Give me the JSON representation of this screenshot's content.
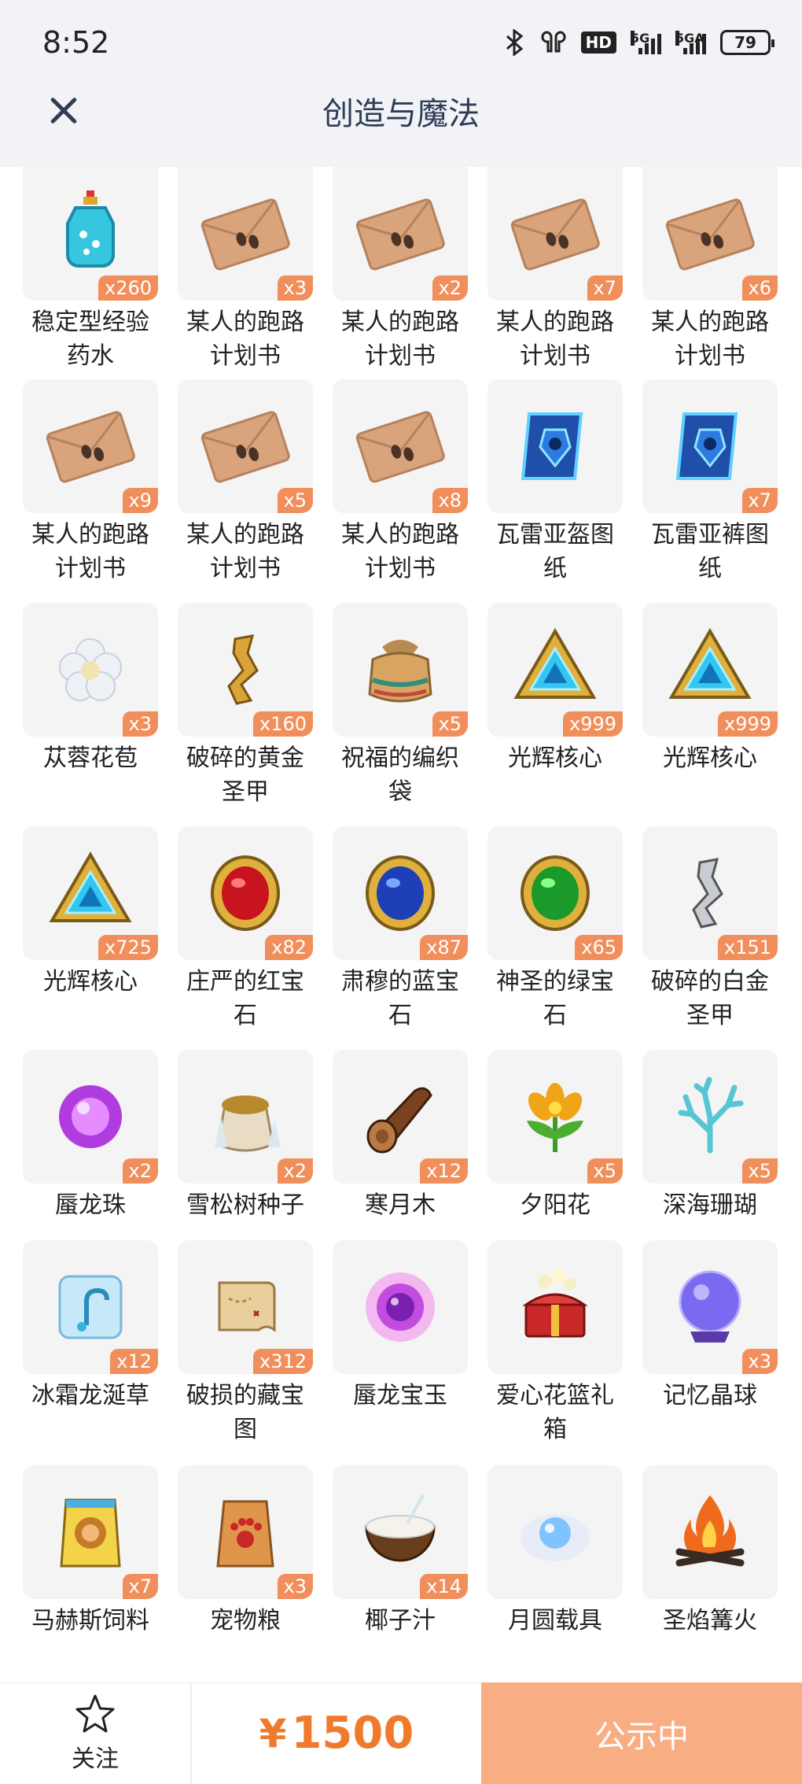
{
  "status": {
    "time": "8:52",
    "battery": "79",
    "hd": "HD",
    "sig1": "5G",
    "sig2": "5GA"
  },
  "header": {
    "title": "创造与魔法"
  },
  "items": [
    {
      "name": "稳定型经验药水",
      "lines": [
        "稳定型经验",
        "药水"
      ],
      "qty": "x260",
      "icon": "potion"
    },
    {
      "name": "某人的跑路计划书",
      "lines": [
        "某人的跑路",
        "计划书"
      ],
      "qty": "x3",
      "icon": "envelope"
    },
    {
      "name": "某人的跑路计划书",
      "lines": [
        "某人的跑路",
        "计划书"
      ],
      "qty": "x2",
      "icon": "envelope"
    },
    {
      "name": "某人的跑路计划书",
      "lines": [
        "某人的跑路",
        "计划书"
      ],
      "qty": "x7",
      "icon": "envelope"
    },
    {
      "name": "某人的跑路计划书",
      "lines": [
        "某人的跑路",
        "计划书"
      ],
      "qty": "x6",
      "icon": "envelope"
    },
    {
      "name": "某人的跑路计划书",
      "lines": [
        "某人的跑路",
        "计划书"
      ],
      "qty": "x9",
      "icon": "envelope"
    },
    {
      "name": "某人的跑路计划书",
      "lines": [
        "某人的跑路",
        "计划书"
      ],
      "qty": "x5",
      "icon": "envelope"
    },
    {
      "name": "某人的跑路计划书",
      "lines": [
        "某人的跑路",
        "计划书"
      ],
      "qty": "x8",
      "icon": "envelope"
    },
    {
      "name": "瓦雷亚盔图纸",
      "lines": [
        "瓦雷亚盔图",
        "纸"
      ],
      "qty": "",
      "icon": "blueprint"
    },
    {
      "name": "瓦雷亚裤图纸",
      "lines": [
        "瓦雷亚裤图",
        "纸"
      ],
      "qty": "x7",
      "icon": "blueprint"
    },
    {
      "name": "苁蓉花苞",
      "lines": [
        "苁蓉花苞"
      ],
      "qty": "x3",
      "icon": "flower-bud"
    },
    {
      "name": "破碎的黄金圣甲",
      "lines": [
        "破碎的黄金",
        "圣甲"
      ],
      "qty": "x160",
      "icon": "gold-shard"
    },
    {
      "name": "祝福的编织袋",
      "lines": [
        "祝福的编织",
        "袋"
      ],
      "qty": "x5",
      "icon": "woven-bag"
    },
    {
      "name": "光辉核心",
      "lines": [
        "光辉核心"
      ],
      "qty": "x999",
      "icon": "radiant-core"
    },
    {
      "name": "光辉核心",
      "lines": [
        "光辉核心"
      ],
      "qty": "x999",
      "icon": "radiant-core"
    },
    {
      "name": "光辉核心",
      "lines": [
        "光辉核心"
      ],
      "qty": "x725",
      "icon": "radiant-core"
    },
    {
      "name": "庄严的红宝石",
      "lines": [
        "庄严的红宝",
        "石"
      ],
      "qty": "x82",
      "icon": "red-gem"
    },
    {
      "name": "肃穆的蓝宝石",
      "lines": [
        "肃穆的蓝宝",
        "石"
      ],
      "qty": "x87",
      "icon": "blue-gem"
    },
    {
      "name": "神圣的绿宝石",
      "lines": [
        "神圣的绿宝",
        "石"
      ],
      "qty": "x65",
      "icon": "green-gem"
    },
    {
      "name": "破碎的白金圣甲",
      "lines": [
        "破碎的白金",
        "圣甲"
      ],
      "qty": "x151",
      "icon": "silver-shard"
    },
    {
      "name": "蜃龙珠",
      "lines": [
        "蜃龙珠"
      ],
      "qty": "x2",
      "icon": "purple-orb"
    },
    {
      "name": "雪松树种子",
      "lines": [
        "雪松树种子"
      ],
      "qty": "x2",
      "icon": "seed-sack"
    },
    {
      "name": "寒月木",
      "lines": [
        "寒月木"
      ],
      "qty": "x12",
      "icon": "log"
    },
    {
      "name": "夕阳花",
      "lines": [
        "夕阳花"
      ],
      "qty": "x5",
      "icon": "sunset-flower"
    },
    {
      "name": "深海珊瑚",
      "lines": [
        "深海珊瑚"
      ],
      "qty": "x5",
      "icon": "coral"
    },
    {
      "name": "冰霜龙涎草",
      "lines": [
        "冰霜龙涎草"
      ],
      "qty": "x12",
      "icon": "ice-cube"
    },
    {
      "name": "破损的藏宝图",
      "lines": [
        "破损的藏宝",
        "图"
      ],
      "qty": "x312",
      "icon": "treasure-map"
    },
    {
      "name": "蜃龙宝玉",
      "lines": [
        "蜃龙宝玉"
      ],
      "qty": "",
      "icon": "dragon-jade"
    },
    {
      "name": "爱心花篮礼箱",
      "lines": [
        "爱心花篮礼",
        "箱"
      ],
      "qty": "",
      "icon": "gift-chest"
    },
    {
      "name": "记忆晶球",
      "lines": [
        "记忆晶球"
      ],
      "qty": "x3",
      "icon": "crystal-ball"
    },
    {
      "name": "马赫斯饲料",
      "lines": [
        "马赫斯饲料"
      ],
      "qty": "x7",
      "icon": "feed-bag"
    },
    {
      "name": "宠物粮",
      "lines": [
        "宠物粮"
      ],
      "qty": "x3",
      "icon": "pet-food"
    },
    {
      "name": "椰子汁",
      "lines": [
        "椰子汁"
      ],
      "qty": "x14",
      "icon": "coconut"
    },
    {
      "name": "月圆载具",
      "lines": [
        "月圆载具"
      ],
      "qty": "",
      "icon": "moon-mount"
    },
    {
      "name": "圣焰篝火",
      "lines": [
        "圣焰篝火"
      ],
      "qty": "",
      "icon": "bonfire"
    }
  ],
  "footer": {
    "follow_label": "关注",
    "currency": "¥",
    "price": "1500",
    "cta_label": "公示中"
  },
  "colors": {
    "accent": "#f07a2c",
    "badge": "#f08f5b",
    "cta_bg": "#f9ad82",
    "title": "#2c3d55"
  }
}
